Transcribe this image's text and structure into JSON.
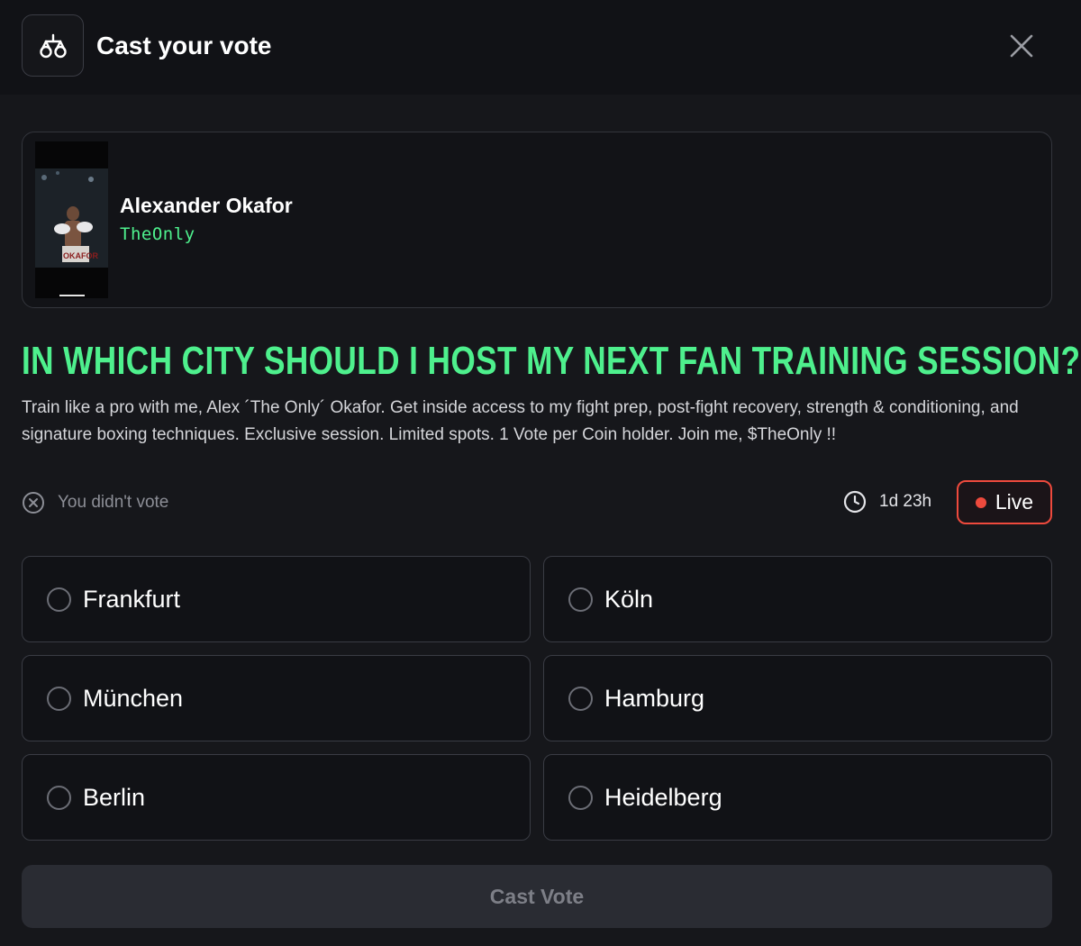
{
  "header": {
    "icon": "scales-icon",
    "title": "Cast your vote",
    "close_icon": "close-icon"
  },
  "creator": {
    "name": "Alexander Okafor",
    "handle": "TheOnly",
    "thumbnail_text": "OKAFOR"
  },
  "poll": {
    "question": "IN WHICH CITY SHOULD I HOST MY NEXT FAN TRAINING SESSION?",
    "description": "Train like a pro with me, Alex ´The Only´ Okafor. Get inside access to my fight prep, post-fight recovery, strength & conditioning, and signature boxing techniques.  Exclusive session. Limited spots. 1 Vote per Coin holder.  Join me, $TheOnly !!",
    "vote_status": "You didn't vote",
    "time_left": "1d 23h",
    "live_label": "Live",
    "options": [
      {
        "label": "Frankfurt"
      },
      {
        "label": "Köln"
      },
      {
        "label": "München"
      },
      {
        "label": "Hamburg"
      },
      {
        "label": "Berlin"
      },
      {
        "label": "Heidelberg"
      }
    ],
    "cast_label": "Cast Vote"
  },
  "colors": {
    "accent_green": "#4ef08d",
    "live_red": "#ee4a3d",
    "background": "#16171b"
  }
}
